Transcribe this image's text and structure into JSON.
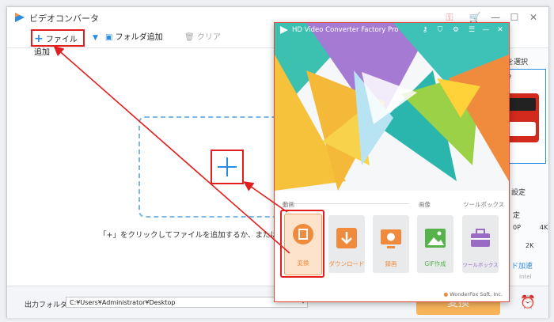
{
  "window": {
    "title": "ビデオコンバータ"
  },
  "toolbar": {
    "add_file": "ファイル追加",
    "add_folder": "フォルダ追加",
    "clear": "クリア"
  },
  "dropzone": {
    "hint": "「+」をクリックしてファイルを追加するか、またはファイル"
  },
  "bottom": {
    "output_label": "出力フォルダ：",
    "output_path": "C:¥Users¥Administrator¥Desktop",
    "convert_label": "変換"
  },
  "right_panel": {
    "format_select": "を選択",
    "format_name": "be",
    "settings": "設定",
    "quality_label": "定",
    "res_a": "0P",
    "res_b": "4K",
    "res_c": "2K",
    "accel": "ド加速",
    "chip": "Intel"
  },
  "popup": {
    "title": "HD Video Converter Factory Pro",
    "sections": {
      "video": "動画",
      "image": "画像",
      "toolbox": "ツールボックス"
    },
    "tiles": [
      {
        "label": "変換",
        "icon": "film-icon",
        "color": "#f0904a"
      },
      {
        "label": "ダウンロード",
        "icon": "download-icon",
        "color": "#f0904a"
      },
      {
        "label": "録画",
        "icon": "screen-record-icon",
        "color": "#f0904a"
      },
      {
        "label": "GIF作成",
        "icon": "image-icon",
        "color": "#56b24a"
      },
      {
        "label": "ツールボックス",
        "icon": "toolbox-icon",
        "color": "#9a6bc4"
      }
    ],
    "footer": "WonderFox Soft, Inc."
  },
  "colors": {
    "accent": "#e21f1f",
    "brand_blue": "#2a8be3",
    "convert": "#f39a2b"
  }
}
